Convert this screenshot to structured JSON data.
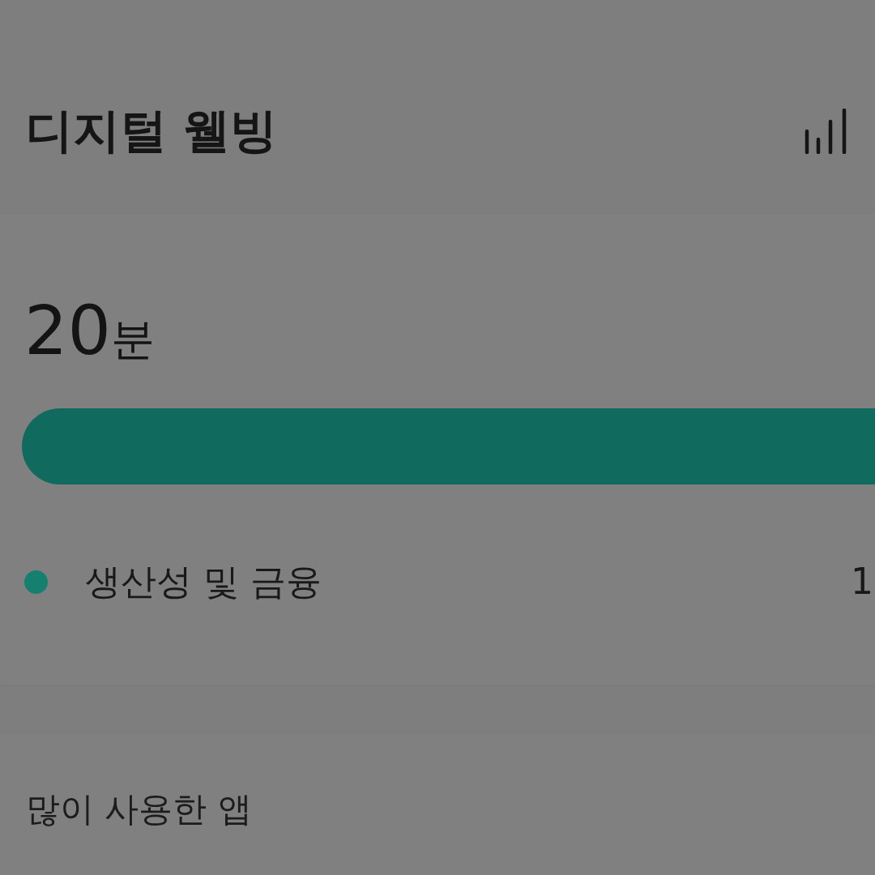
{
  "header": {
    "title": "디지털 웰빙"
  },
  "summary": {
    "total_time": {
      "value": "20",
      "unit": "분"
    },
    "usage_bar": {
      "segments": [
        {
          "color": "#106a5e"
        }
      ]
    }
  },
  "categories": [
    {
      "name": "생산성 및 금융",
      "time": "1",
      "color": "#15806f"
    }
  ],
  "most_used": {
    "title": "많이 사용한 앱"
  }
}
